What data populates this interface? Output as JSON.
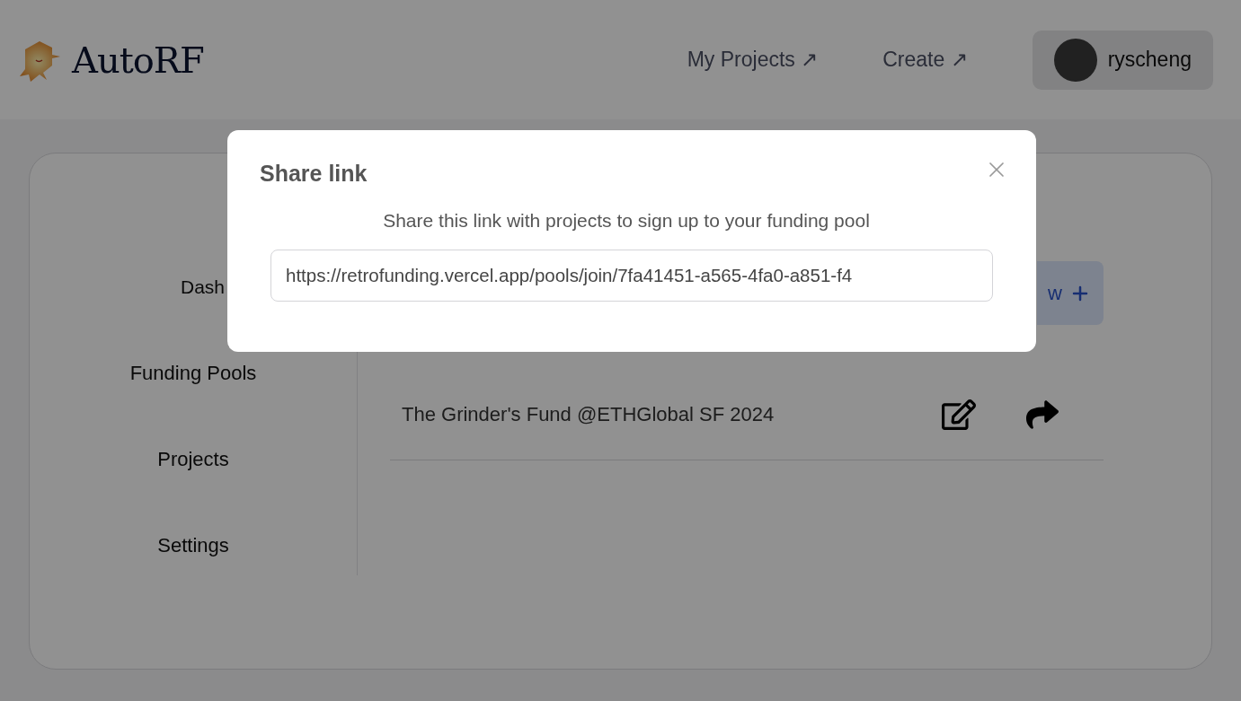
{
  "header": {
    "logo_text": "AutoRF",
    "nav_links": [
      {
        "label": "My Projects",
        "icon": "↗"
      },
      {
        "label": "Create",
        "icon": "↗"
      }
    ],
    "user": {
      "name": "ryscheng"
    }
  },
  "sidebar": {
    "items": [
      {
        "label": "Dash"
      },
      {
        "label": "Funding Pools"
      },
      {
        "label": "Projects"
      },
      {
        "label": "Settings"
      }
    ]
  },
  "main": {
    "new_button": {
      "label": "w"
    },
    "pools": [
      {
        "name": "The Grinder's Fund @ETHGlobal SF 2024"
      }
    ]
  },
  "modal": {
    "title": "Share link",
    "description": "Share this link with projects to sign up to your funding pool",
    "link": "https://retrofunding.vercel.app/pools/join/7fa41451-a565-4fa0-a851-f4"
  }
}
